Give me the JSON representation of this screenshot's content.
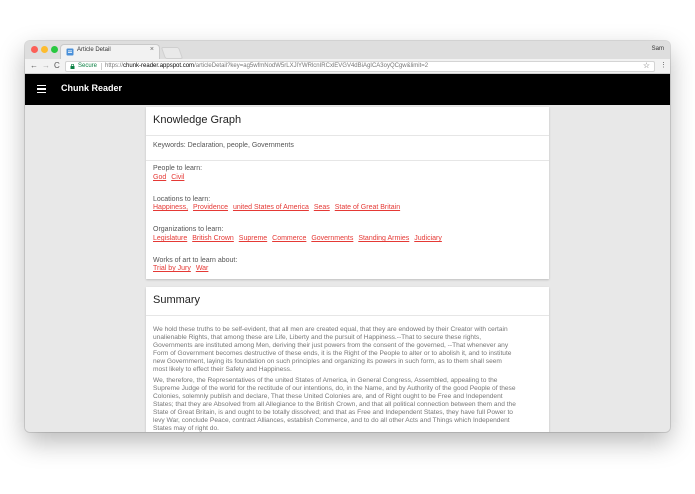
{
  "browser": {
    "tab_title": "Article Detail",
    "tab_close": "×",
    "profile_name": "Sam",
    "secure_label": "Secure",
    "url_scheme": "https://",
    "url_host": "chunk-reader.appspot.com",
    "url_path": "/articleDetail?key=ag5wfmNodW5rLXJlYWRlcnIRCxlEVGV4dBiAgICA3oyQCgw&limit=2",
    "back_glyph": "←",
    "forward_glyph": "→",
    "reload_glyph": "C",
    "star_glyph": "☆",
    "menu_glyph": "⋮"
  },
  "app": {
    "title": "Chunk Reader"
  },
  "knowledge_graph": {
    "title": "Knowledge Graph",
    "keywords": "Keywords: Declaration, people, Governments",
    "people": {
      "label": "People to learn:",
      "items": [
        "God",
        "Civil"
      ]
    },
    "locations": {
      "label": "Locations to learn:",
      "items": [
        "Happiness,",
        "Providence",
        "united States of America",
        "Seas",
        "State of Great Britain"
      ]
    },
    "organizations": {
      "label": "Organizations to learn:",
      "items": [
        "Legislature",
        "British Crown",
        "Supreme",
        "Commerce",
        "Governments",
        "Standing Armies",
        "Judiciary"
      ]
    },
    "works_of_art": {
      "label": "Works of art to learn about:",
      "items": [
        "Trial by Jury",
        "War"
      ]
    }
  },
  "summary": {
    "title": "Summary",
    "paragraphs": [
      "We hold these truths to be self-evident, that all men are created equal, that they are endowed by their Creator with certain unalienable Rights, that among these are Life, Liberty and the pursuit of Happiness.--That to secure these rights, Governments are instituted among Men, deriving their just powers from the consent of the governed, --That whenever any Form of Government becomes destructive of these ends, it is the Right of the People to alter or to abolish it, and to institute new Government, laying its foundation on such principles and organizing its powers in such form, as to them shall seem most likely to effect their Safety and Happiness.",
      "We, therefore, the Representatives of the united States of America, in General Congress, Assembled, appealing to the Supreme Judge of the world for the rectitude of our intentions, do, in the Name, and by Authority of the good People of these Colonies, solemnly publish and declare, That these United Colonies are, and of Right ought to be Free and Independent States; that they are Absolved from all Allegiance to the British Crown, and that all political connection between them and the State of Great Britain, is and ought to be totally dissolved; and that as Free and Independent States, they have full Power to levy War, conclude Peace, contract Alliances, establish Commerce, and to do all other Acts and Things which Independent States may of right do."
    ]
  },
  "colors": {
    "app_bar": "#000000",
    "link": "#e53935",
    "page_background": "#e8e8e8",
    "secure": "#0b8043"
  },
  "icons": {
    "menu": "hamburger-menu-icon",
    "lock": "lock-icon",
    "favicon": "document-favicon-icon",
    "bookmark": "star-icon"
  }
}
